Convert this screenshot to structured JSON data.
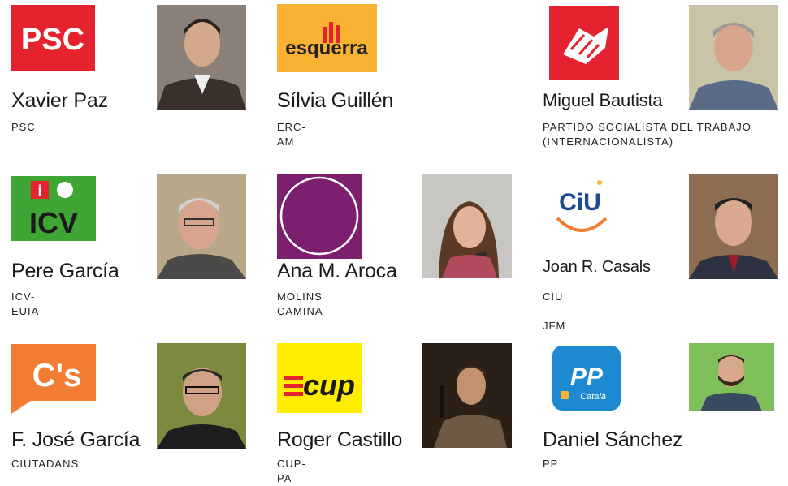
{
  "candidates": [
    {
      "name": "Xavier Paz",
      "party": "PSC",
      "logo": {
        "icon": "psc-logo",
        "text": "PSC",
        "color": "#E5232F"
      }
    },
    {
      "name": "Sílvia Guillén",
      "party": "ERC-AM",
      "logo": {
        "icon": "esquerra-logo",
        "text": "esquerra",
        "color": "#F9B232"
      }
    },
    {
      "name": "Miguel Bautista",
      "party": "PARTIDO SOCIALISTA DEL TRABAJO (INTERNACIONALISTA)",
      "logo": {
        "icon": "handshake-logo",
        "color": "#E5232F"
      }
    },
    {
      "name": "Pere García",
      "party": "ICV-EUIA",
      "logo": {
        "icon": "icv-logo",
        "text": "ICV",
        "color": "#3FA535"
      }
    },
    {
      "name": "Ana M. Aroca",
      "party": "MOLINS CAMINA",
      "logo": {
        "icon": "molins-camina-logo",
        "color": "#7B1F6E"
      }
    },
    {
      "name": "Joan R. Casals",
      "party": "CIU - JFM",
      "logo": {
        "icon": "ciu-logo",
        "text": "CiU",
        "color": "#1C4C96"
      }
    },
    {
      "name": "F. José García",
      "party": "CIUTADANS",
      "logo": {
        "icon": "ciutadans-logo",
        "text": "C's",
        "color": "#F07D32"
      }
    },
    {
      "name": "Roger Castillo",
      "party": "CUP-PA",
      "logo": {
        "icon": "cup-logo",
        "text": "cup",
        "color": "#FFED00"
      }
    },
    {
      "name": "Daniel Sánchez",
      "party": "PP",
      "logo": {
        "icon": "pp-logo",
        "text": "PP",
        "subtext": "Català",
        "color": "#1D89D1"
      }
    }
  ]
}
